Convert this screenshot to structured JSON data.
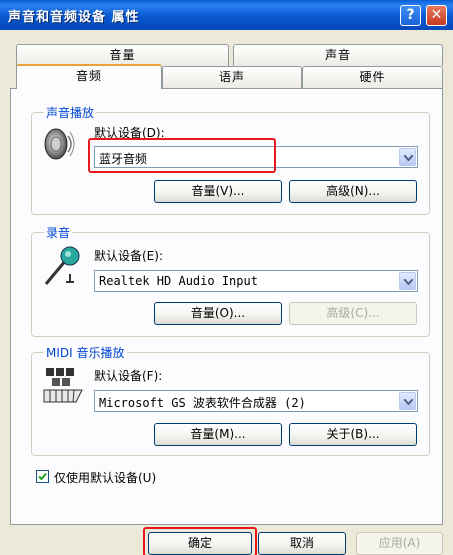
{
  "window": {
    "title": "声音和音频设备 属性",
    "help_label": "?",
    "close_label": "✕"
  },
  "tabs": {
    "back": [
      "音量",
      "声音"
    ],
    "front": [
      "音频",
      "语声",
      "硬件"
    ]
  },
  "sound_playback": {
    "title": "声音播放",
    "device_label": "默认设备(D):",
    "device_value": "蓝牙音频",
    "volume_button": "音量(V)...",
    "advanced_button": "高级(N)..."
  },
  "recording": {
    "title": "录音",
    "device_label": "默认设备(E):",
    "device_value": "Realtek HD Audio Input",
    "volume_button": "音量(O)...",
    "advanced_button": "高级(C)..."
  },
  "midi": {
    "title": "MIDI 音乐播放",
    "device_label": "默认设备(F):",
    "device_value": "Microsoft GS 波表软件合成器 (2)",
    "volume_button": "音量(M)...",
    "about_button": "关于(B)..."
  },
  "only_default_checkbox": {
    "label": "仅使用默认设备(U)",
    "checked": true
  },
  "footer": {
    "ok_button": "确定",
    "cancel_button": "取消",
    "apply_button": "应用(A)"
  },
  "colors": {
    "titlebar": "#0858d0",
    "highlight_box": "#e8191c",
    "group_title": "#0046d5"
  }
}
